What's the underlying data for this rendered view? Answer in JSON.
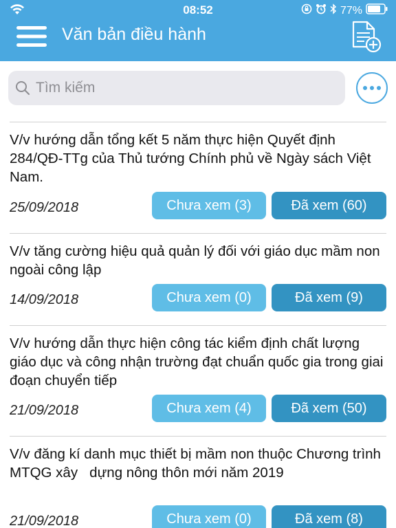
{
  "status_bar": {
    "time": "08:52",
    "battery": "77%",
    "icons": [
      "wifi-icon",
      "rotation-lock-icon",
      "alarm-icon",
      "bluetooth-icon",
      "battery-icon"
    ]
  },
  "header": {
    "title": "Văn bản điều hành",
    "menu_icon": "hamburger-menu-icon",
    "add_icon": "add-document-icon"
  },
  "search": {
    "placeholder": "Tìm kiếm",
    "value": ""
  },
  "colors": {
    "header_bg": "#4aa8e0",
    "unread_button": "#5fbde6",
    "read_button": "#3393c2",
    "search_bg": "#e9e9ee"
  },
  "documents": [
    {
      "title": "V/v hướng dẫn tổng kết 5 năm thực hiện Quyết định 284/QĐ-TTg của Thủ tướng Chính phủ về Ngày sách Việt Nam.",
      "date": "25/09/2018",
      "unread_label": "Chưa xem (3)",
      "read_label": "Đã xem (60)"
    },
    {
      "title": "V/v tăng cường hiệu quả quản lý đối với giáo dục mầm non ngoài công lập",
      "date": "14/09/2018",
      "unread_label": "Chưa xem (0)",
      "read_label": "Đã xem (9)"
    },
    {
      "title": "V/v hướng dẫn thực hiện công tác kiểm định chất lượng giáo dục và công nhận trường đạt chuẩn quốc gia trong giai đoạn chuyển tiếp",
      "date": "21/09/2018",
      "unread_label": "Chưa xem (4)",
      "read_label": "Đã xem (50)"
    },
    {
      "title": "V/v đăng kí danh mục thiết bị mầm non thuộc Chương trình MTQG xây   dựng nông thôn mới năm 2019",
      "date": "21/09/2018",
      "unread_label": "Chưa xem (0)",
      "read_label": "Đã xem (8)"
    }
  ]
}
